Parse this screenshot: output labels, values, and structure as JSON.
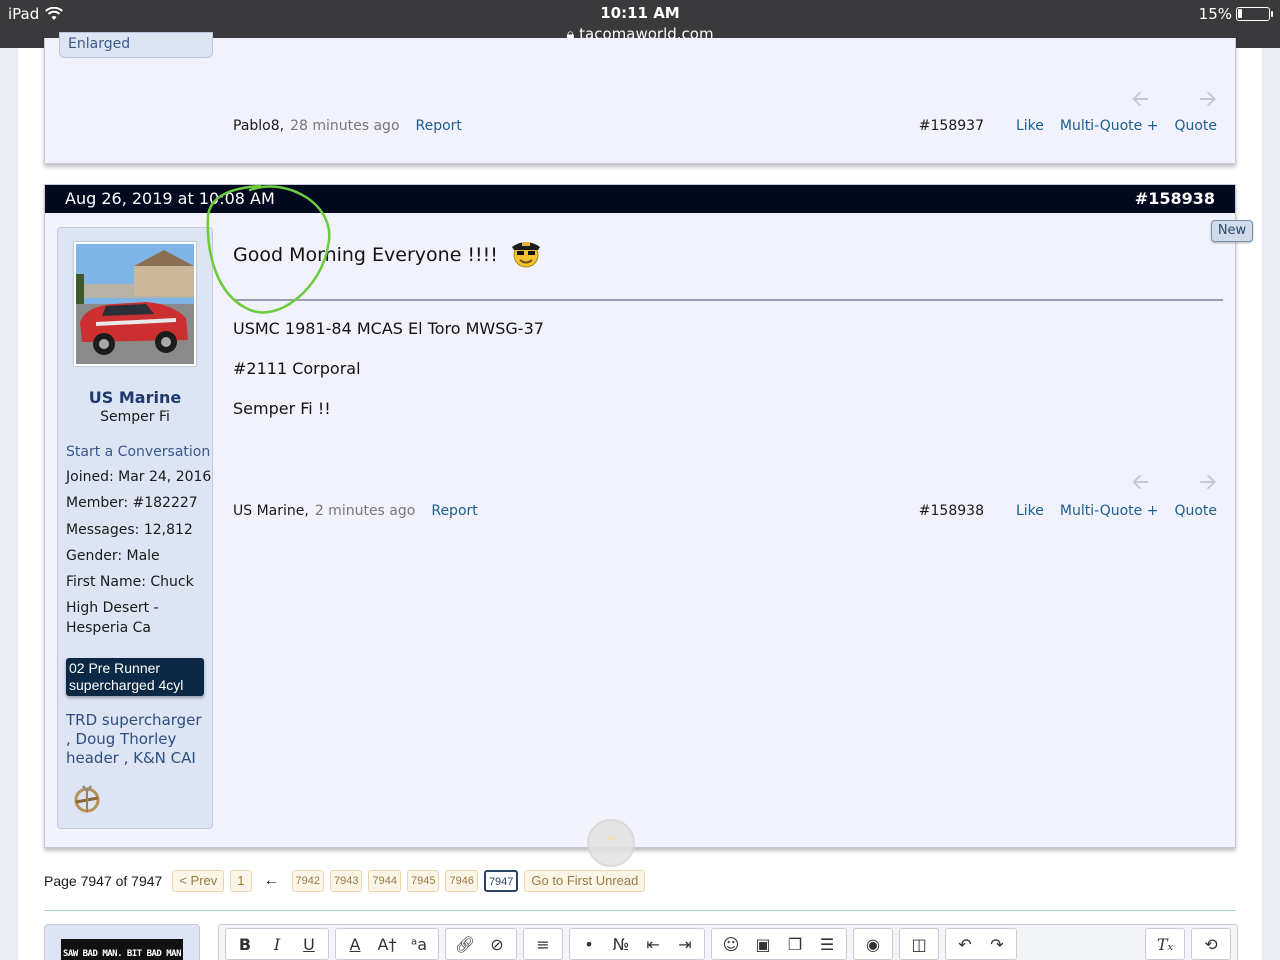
{
  "status_bar": {
    "device": "iPad",
    "time": "10:11 AM",
    "url": "tacomaworld.com",
    "battery": "15%",
    "battery_level": 0.15
  },
  "previous_post": {
    "signature_text": "Enlarged Gasshole!",
    "author": "Pablo8,",
    "time_ago": "28 minutes ago",
    "report": "Report",
    "post_number": "#158937",
    "like": "Like",
    "multi_quote": "Multi-Quote +",
    "quote": "Quote"
  },
  "post": {
    "date": "Aug 26, 2019 at 10:08 AM",
    "permalink": "#158938",
    "new_badge": "New",
    "title": "Good Morning Everyone !!!!",
    "lines": [
      "USMC 1981-84 MCAS El Toro MWSG-37",
      "#2111 Corporal",
      "Semper Fi !!"
    ],
    "footer": {
      "author": "US Marine,",
      "time_ago": "2 minutes ago",
      "report": "Report",
      "post_number": "#158938",
      "like": "Like",
      "multi_quote": "Multi-Quote +",
      "quote": "Quote"
    }
  },
  "user": {
    "name": "US Marine",
    "title": "Semper Fi",
    "start_conversation": "Start a Conversation",
    "info": [
      "Joined:  Mar 24, 2016",
      "Member:  #182227",
      "Messages:  12,812",
      "Gender:  Male",
      "First Name:  Chuck",
      "High Desert -",
      "Hesperia Ca"
    ],
    "vehicle": [
      "02 Pre Runner",
      "supercharged 4cyl"
    ],
    "mods": "TRD supercharger , Doug Thorley header , K&N CAI"
  },
  "pagination": {
    "label": "Page 7947 of 7947",
    "prev": "< Prev",
    "first": "1",
    "arrow": "←",
    "pages": [
      "7942",
      "7943",
      "7944",
      "7945",
      "7946"
    ],
    "current": "7947",
    "first_unread": "Go to First Unread"
  },
  "reply": {
    "avatar_text": "SAW BAD MAN. BIT BAD MAN"
  },
  "toolbar": {
    "bold": "B",
    "italic": "I",
    "underline": "U",
    "font_color": "A",
    "font_size": "A†",
    "font_family": "ᵃa",
    "clear_format": "Tₓ"
  },
  "colors": {
    "date_bar": "#03091f",
    "link": "#1d5d8f",
    "annotation": "#6ccb3c",
    "vehicle_badge": "#0b2944"
  }
}
